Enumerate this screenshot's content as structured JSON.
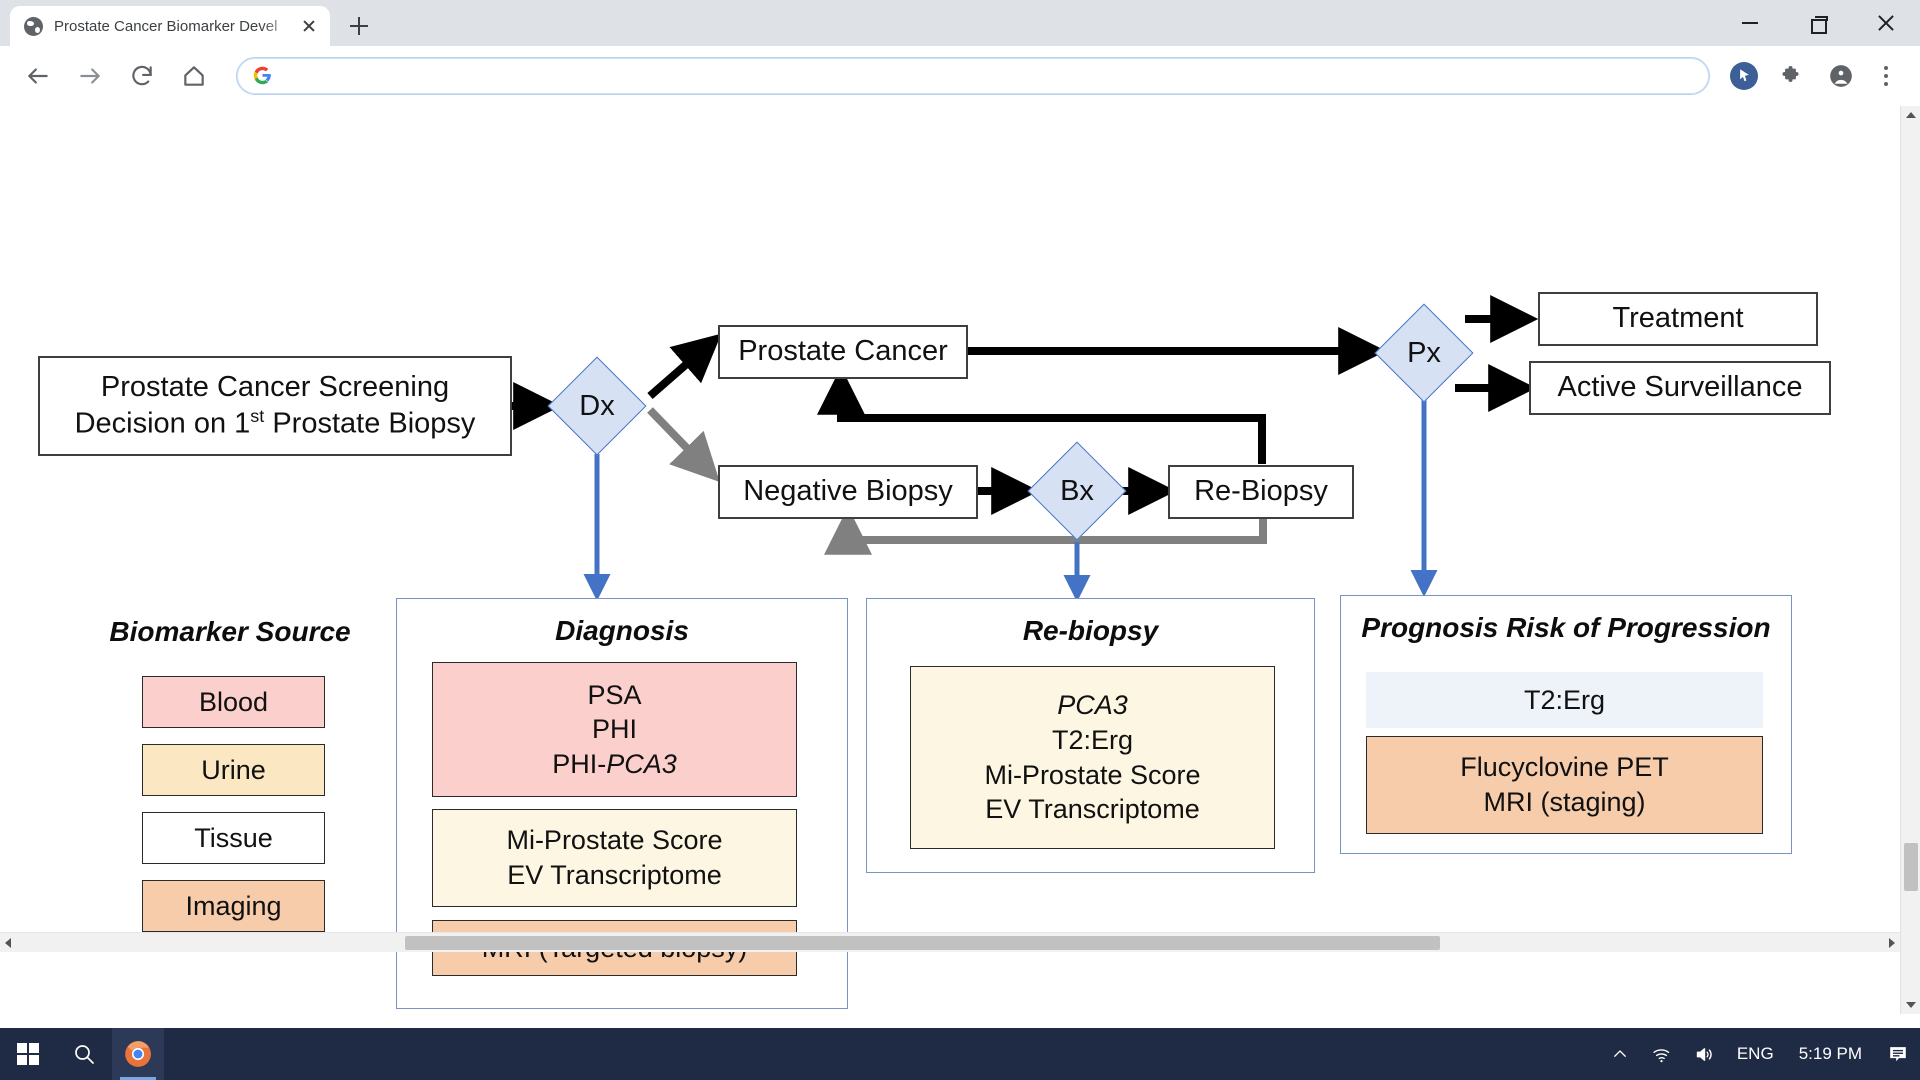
{
  "browser": {
    "tab": {
      "title": "Prostate Cancer Biomarker Devel",
      "favicon": "globe-icon",
      "close": "×"
    },
    "new_tab_label": "+",
    "window_controls": {
      "minimize": "minimize-icon",
      "maximize": "maximize-icon",
      "close": "close-icon"
    },
    "toolbar": {
      "back": "back-arrow-icon",
      "forward": "forward-arrow-icon",
      "reload": "reload-icon",
      "home": "home-icon",
      "address_value": "",
      "address_placeholder": "",
      "search_engine_icon": "google-g-icon",
      "cursor_tool": "cursor-pointer-icon",
      "extensions": "puzzle-piece-icon",
      "profile": "account-avatar-icon",
      "menu": "three-dot-menu-icon"
    }
  },
  "diagram": {
    "nodes": {
      "screening": "Prostate Cancer Screening\nDecision on 1st Prostate Biopsy",
      "screening_line1": "Prostate Cancer Screening",
      "screening_line2_a": "Decision on 1",
      "screening_line2_sup": "st",
      "screening_line2_b": " Prostate Biopsy",
      "dx": "Dx",
      "bx": "Bx",
      "px": "Px",
      "prostate_cancer": "Prostate Cancer",
      "negative_biopsy": "Negative Biopsy",
      "re_biopsy": "Re-Biopsy",
      "treatment": "Treatment",
      "active_surveillance": "Active Surveillance"
    },
    "legend": {
      "title": "Biomarker Source",
      "items": [
        {
          "label": "Blood",
          "color": "#fbcfcc"
        },
        {
          "label": "Urine",
          "color": "#fbe8c3"
        },
        {
          "label": "Tissue",
          "color": "#ffffff"
        },
        {
          "label": "Imaging",
          "color": "#f7ccab"
        }
      ]
    },
    "panels": [
      {
        "title": "Diagnosis",
        "chips": [
          {
            "lines": [
              "PSA",
              "PHI",
              "PHI-PCA3"
            ],
            "italic_tail": "PCA3",
            "color": "#fbcfcc"
          },
          {
            "lines": [
              "Mi-Prostate Score",
              "EV Transcriptome"
            ],
            "color": "#fdf6e3"
          },
          {
            "lines": [
              "MRI (Targeted biopsy)"
            ],
            "color": "#f7ccab"
          }
        ]
      },
      {
        "title": "Re-biopsy",
        "chips": [
          {
            "lines": [
              "PCA3",
              "T2:Erg",
              "Mi-Prostate Score",
              "EV Transcriptome"
            ],
            "italic_first": "PCA3",
            "color": "#fdf6e3"
          }
        ]
      },
      {
        "title": "Prognosis Risk of Progression",
        "chips": [
          {
            "lines": [
              "T2:Erg"
            ],
            "color": "#eef3f9",
            "borderless": true
          },
          {
            "lines": [
              "Flucyclovine PET",
              "MRI (staging)"
            ],
            "color": "#f7ccab"
          }
        ]
      }
    ],
    "colors": {
      "diamond_fill": "#d6e1f3",
      "diamond_stroke": "#4472c4",
      "blue_connector": "#4472c4",
      "gray_connector": "#808080",
      "black_connector": "#000000",
      "panel_border": "#7794c4"
    }
  },
  "taskbar": {
    "start": "windows-start-icon",
    "search": "search-icon",
    "chrome": "chrome-icon",
    "chevron_up": "show-hidden-icons-icon",
    "network": "wifi-icon",
    "volume": "speaker-icon",
    "language": "ENG",
    "clock": "5:19 PM",
    "notifications": "notification-center-icon"
  }
}
